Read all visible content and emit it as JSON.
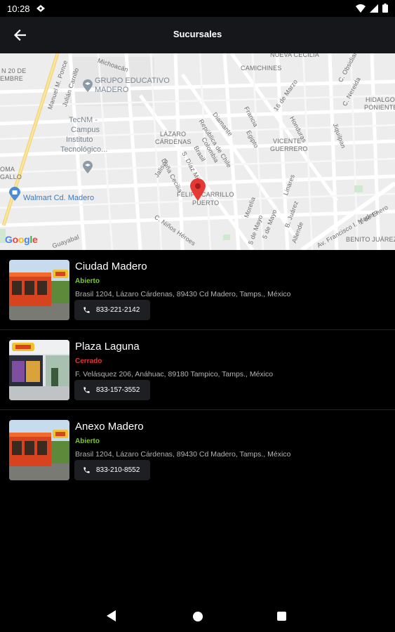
{
  "status_bar": {
    "time": "10:28",
    "icons": [
      "notification-icon",
      "wifi-icon",
      "signal-icon",
      "battery-icon"
    ]
  },
  "app_bar": {
    "title": "Sucursales",
    "back_icon": "arrow-back-icon"
  },
  "map": {
    "google_logo": "Google",
    "pin_color": "#e53935",
    "labels": {
      "street_20_de_noviembre_1": "N 20 DE",
      "street_20_de_noviembre_2": "EMBRE",
      "manuel_ponce": "Manuel M. Ponce",
      "julian_carrillo": "Julián Carrillo",
      "michoacan": "Michoacán",
      "nueva_cecilia": "NUEVA CECILIA",
      "camichines": "CAMICHINES",
      "c_obsidiana": "C. Obsidiana",
      "c_nereida": "C. Nereida",
      "hidalgo_poniente_1": "HIDALGO",
      "hidalgo_poniente_2": "PONIENTE",
      "diamante": "Diamante",
      "republica_de_chile": "República de Chile",
      "francia": "Francia",
      "dieciseis_de_marzo": "16 de Marzo",
      "honduras": "Honduras",
      "jiquilpan": "Jiquilpan",
      "lazaro_cardenas_1": "LÁZARO",
      "lazaro_cardenas_2": "CÁRDENAS",
      "colombia": "Colombia",
      "brasil": "Brasil",
      "egipto": "Egipto",
      "vicente_guerrero_1": "VICENTE",
      "vicente_guerrero_2": "GUERRERO",
      "s_diaz_miron": "S. Díaz Mirón",
      "dona_cecilia": "Doña Cecilia",
      "jalisco": "Jalisco",
      "felipe_carrillo_puerto_1": "FELIPE CARRILLO",
      "felipe_carrillo_puerto_2": "PUERTO",
      "morelia": "Morelia",
      "linares": "Linares",
      "c_ninos_heroes": "C. Niños Héroes",
      "cinco_de_mayo_1": "5 de Mayo",
      "cinco_de_mayo_2": "5 de Mayo",
      "b_juarez": "B. Juárez",
      "allende": "Allende",
      "av_francisco_madero": "Av. Francisco I. Madero",
      "primero_de_enero": "1 de Enero",
      "benito_juarez": "BENITO JUÁREZ",
      "guayabal": "Guayabal",
      "oma_gallo_1": "OMA",
      "oma_gallo_2": "GALLO"
    },
    "pois": {
      "grupo_educativo_1": "GRUPO EDUCATIVO",
      "grupo_educativo_2": "MADERO",
      "tecnm_1": "TecNM -",
      "tecnm_2": "Campus",
      "tecnm_3": "Instituto",
      "tecnm_4": "Tecnológico...",
      "walmart": "Walmart Cd. Madero"
    }
  },
  "branches": [
    {
      "name": "Ciudad Madero",
      "status": "Abierto",
      "status_color": "#7cc828",
      "address": "Brasil 1204, Lázaro Cárdenas, 89430 Cd Madero, Tamps., México",
      "phone": "833-221-2142"
    },
    {
      "name": "Plaza Laguna",
      "status": "Cerrado",
      "status_color": "#e53535",
      "address": "F. Velásquez 206, Anáhuac, 89180 Tampico, Tamps., México",
      "phone": "833-157-3552"
    },
    {
      "name": "Anexo Madero",
      "status": "Abierto",
      "status_color": "#7cc828",
      "address": "Brasil 1204, Lázaro Cárdenas, 89430 Cd Madero, Tamps., México",
      "phone": "833-210-8552"
    }
  ],
  "nav_bar": {
    "icons": [
      "nav-back-icon",
      "nav-home-icon",
      "nav-recents-icon"
    ]
  }
}
